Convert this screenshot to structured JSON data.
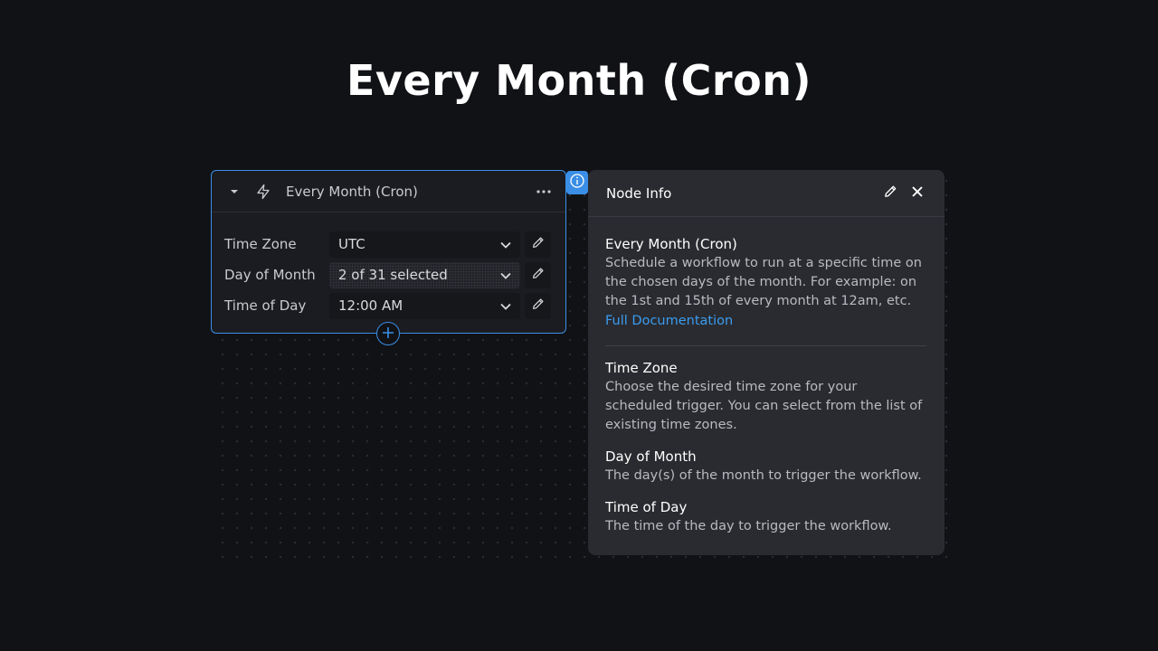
{
  "page": {
    "title": "Every Month (Cron)"
  },
  "node": {
    "title": "Every Month (Cron)",
    "icons": {
      "collapse": "chevron-down-icon",
      "trigger": "lightning-bolt-icon",
      "menu": "more-horizontal-icon",
      "add": "plus-circle-icon",
      "info": "info-icon"
    },
    "fields": [
      {
        "label": "Time Zone",
        "value": "UTC"
      },
      {
        "label": "Day of Month",
        "value": "2 of 31 selected"
      },
      {
        "label": "Time of Day",
        "value": "12:00 AM"
      }
    ]
  },
  "panel": {
    "title": "Node Info",
    "icons": {
      "edit": "pencil-icon",
      "close": "close-icon"
    },
    "intro": {
      "title": "Every Month (Cron)",
      "text": "Schedule a workflow to run at a specific time on the chosen days of the month. For example: on the 1st and 15th of every month at 12am, etc.",
      "link": "Full Documentation"
    },
    "sections": [
      {
        "title": "Time Zone",
        "text": "Choose the desired time zone for your scheduled trigger. You can select from the list of existing time zones."
      },
      {
        "title": "Day of Month",
        "text": "The day(s) of the month to trigger the workflow."
      },
      {
        "title": "Time of Day",
        "text": "The time of the day to trigger the workflow."
      }
    ]
  },
  "colors": {
    "accent": "#3a8ee6",
    "link": "#3a9cf0",
    "background": "#111216",
    "panel": "#2a2b30"
  }
}
